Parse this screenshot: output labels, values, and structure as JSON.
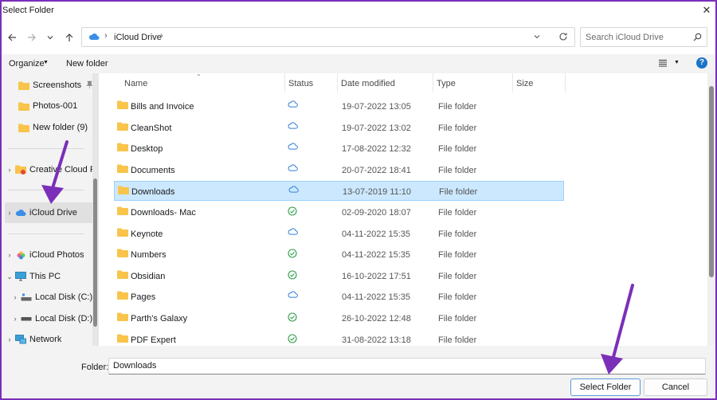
{
  "window": {
    "title": "Select Folder",
    "close_symbol": "✕"
  },
  "address": {
    "location": "iCloud Drive",
    "separator": "›",
    "search_placeholder": "Search iCloud Drive"
  },
  "toolbar": {
    "organize_label": "Organize",
    "new_folder_label": "New folder",
    "help_label": "?"
  },
  "sidebar": {
    "items": [
      {
        "label": "Screenshots",
        "pinned": true
      },
      {
        "label": "Photos-001"
      },
      {
        "label": "New folder (9)"
      },
      {
        "label": "Creative Cloud Files"
      },
      {
        "label": "iCloud Drive"
      },
      {
        "label": "iCloud Photos"
      },
      {
        "label": "This PC"
      },
      {
        "label": "Local Disk (C:)"
      },
      {
        "label": "Local Disk (D:)"
      },
      {
        "label": "Network"
      }
    ]
  },
  "columns": {
    "name": "Name",
    "status": "Status",
    "date": "Date modified",
    "type": "Type",
    "size": "Size"
  },
  "files": [
    {
      "name": "Bills and Invoice",
      "status": "cloud",
      "date": "19-07-2022 13:05",
      "type": "File folder"
    },
    {
      "name": "CleanShot",
      "status": "cloud",
      "date": "19-07-2022 13:02",
      "type": "File folder"
    },
    {
      "name": "Desktop",
      "status": "cloud",
      "date": "17-08-2022 12:32",
      "type": "File folder"
    },
    {
      "name": "Documents",
      "status": "cloud",
      "date": "20-07-2022 18:41",
      "type": "File folder"
    },
    {
      "name": "Downloads",
      "status": "cloud",
      "date": "13-07-2019 11:10",
      "type": "File folder"
    },
    {
      "name": "Downloads- Mac",
      "status": "check",
      "date": "02-09-2020 18:07",
      "type": "File folder"
    },
    {
      "name": "Keynote",
      "status": "cloud",
      "date": "04-11-2022 15:35",
      "type": "File folder"
    },
    {
      "name": "Numbers",
      "status": "check",
      "date": "04-11-2022 15:35",
      "type": "File folder"
    },
    {
      "name": "Obsidian",
      "status": "check",
      "date": "16-10-2022 17:51",
      "type": "File folder"
    },
    {
      "name": "Pages",
      "status": "cloud",
      "date": "04-11-2022 15:35",
      "type": "File folder"
    },
    {
      "name": "Parth's Galaxy",
      "status": "check",
      "date": "26-10-2022 12:48",
      "type": "File folder"
    },
    {
      "name": "PDF Expert",
      "status": "check",
      "date": "31-08-2022 13:18",
      "type": "File folder"
    }
  ],
  "bottom": {
    "folder_label": "Folder:",
    "folder_value": "Downloads",
    "select_label": "Select Folder",
    "cancel_label": "Cancel"
  },
  "colors": {
    "accent": "#0067c0",
    "selection": "#cce8ff",
    "folder": "#f8c44a",
    "annotation": "#7b2fb8"
  }
}
